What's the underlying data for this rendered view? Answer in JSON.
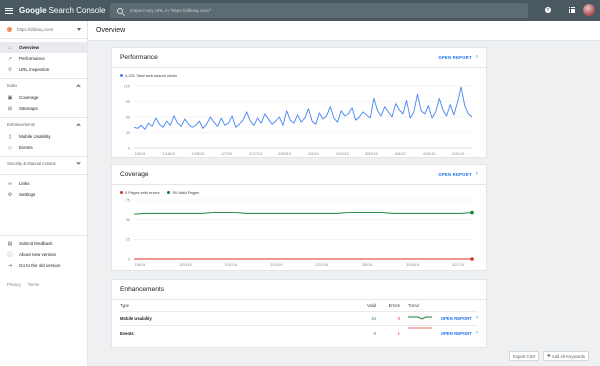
{
  "app": {
    "brand_g": "Google",
    "brand_text": "Search Console"
  },
  "search": {
    "placeholder": "Inspect any URL in \"https://dilinsq.com/\""
  },
  "header_icons": {
    "help": "?"
  },
  "property": {
    "url": "https://dilinsq.com/"
  },
  "sidebar": {
    "items": [
      {
        "label": "Overview",
        "icon": "home-icon"
      },
      {
        "label": "Performance",
        "icon": "trending-icon"
      },
      {
        "label": "URL inspection",
        "icon": "search-icon"
      }
    ],
    "index_section": "Index",
    "index_items": [
      {
        "label": "Coverage",
        "icon": "coverage-icon"
      },
      {
        "label": "Sitemaps",
        "icon": "sitemaps-icon"
      }
    ],
    "enh_section": "Enhancements",
    "enh_items": [
      {
        "label": "Mobile Usability",
        "icon": "phone-icon"
      },
      {
        "label": "Events",
        "icon": "events-icon"
      }
    ],
    "security_section": "Security & Manual Actions",
    "other_items": [
      {
        "label": "Links",
        "icon": "links-icon"
      },
      {
        "label": "Settings",
        "icon": "gear-icon"
      }
    ],
    "bottom_items": [
      {
        "label": "Submit feedback",
        "icon": "feedback-icon"
      },
      {
        "label": "About new version",
        "icon": "info-icon"
      },
      {
        "label": "Go to the old version",
        "icon": "exit-icon"
      }
    ],
    "footer": [
      "Privacy",
      "Terms"
    ]
  },
  "main": {
    "title": "Overview"
  },
  "performance": {
    "title": "Performance",
    "open": "OPEN REPORT",
    "legend": "4,231 Total web search clicks",
    "chart_data": {
      "type": "line",
      "series": [
        {
          "name": "4,231 Total web search clicks",
          "color": "#4285f4",
          "values": [
            40,
            38,
            44,
            36,
            48,
            42,
            58,
            46,
            40,
            52,
            44,
            62,
            48,
            42,
            56,
            46,
            40,
            44,
            52,
            38,
            46,
            60,
            50,
            42,
            58,
            44,
            48,
            62,
            40,
            46,
            54,
            70,
            52,
            44,
            58,
            48,
            66,
            56,
            46,
            52,
            60,
            44,
            72,
            54,
            48,
            64,
            50,
            58,
            76,
            52,
            46,
            68,
            56,
            62,
            80,
            58,
            50,
            72,
            62,
            66,
            78,
            54,
            60,
            70,
            64,
            58,
            96,
            72,
            62,
            80,
            70,
            60,
            86,
            74,
            66,
            92,
            58,
            70,
            104,
            72,
            66,
            82,
            58,
            70,
            96,
            74,
            62,
            84,
            64,
            88,
            118,
            82,
            66,
            60
          ]
        }
      ],
      "x_ticks": [
        "1/8/19",
        "1/18/19",
        "1/28/19",
        "2/7/19",
        "2/17/19",
        "2/28/19",
        "3/9/19",
        "3/19/19",
        "3/29/19",
        "4/8/19",
        "4/18/19",
        "4/31/19"
      ],
      "y_ticks": [
        "0",
        "30",
        "60",
        "90",
        "120"
      ],
      "ylim": [
        0,
        120
      ]
    }
  },
  "coverage": {
    "title": "Coverage",
    "open": "OPEN REPORT",
    "legend_errors": "0 Pages with errors",
    "legend_valid": "59 Valid Pages",
    "chart_data": {
      "type": "line",
      "series": [
        {
          "name": "59 Valid Pages",
          "color": "#188038",
          "values": [
            57,
            58,
            58,
            58,
            58,
            58,
            58,
            59,
            59,
            59,
            58,
            58,
            58,
            58,
            58,
            58,
            58,
            58,
            58,
            59,
            59,
            59,
            59,
            58,
            58,
            58,
            58,
            58,
            58,
            58,
            59
          ]
        },
        {
          "name": "0 Pages with errors",
          "color": "#d93025",
          "values": [
            0,
            0,
            0,
            0,
            0,
            0,
            0,
            0,
            0,
            0,
            0,
            0,
            0,
            0,
            0,
            0,
            0,
            0,
            0,
            0,
            0,
            0,
            0,
            0,
            0,
            0,
            0,
            0,
            0,
            0,
            0
          ]
        }
      ],
      "x_ticks": [
        "1/8/19",
        "1/20/19",
        "1/31/19",
        "2/11/19",
        "2/22/19",
        "3/5/19",
        "3/16/19",
        "3/27/19"
      ],
      "y_ticks": [
        "0",
        "25",
        "50",
        "75"
      ],
      "ylim": [
        0,
        75
      ]
    }
  },
  "enhancements": {
    "title": "Enhancements",
    "headers": {
      "type": "Type",
      "valid": "Valid",
      "errors": "Errors",
      "trend": "Trend"
    },
    "rows": [
      {
        "type": "Mobile Usability",
        "valid": "44",
        "errors": "0",
        "open": "OPEN REPORT"
      },
      {
        "type": "Events",
        "valid": "0",
        "errors": "1",
        "open": "OPEN REPORT"
      }
    ]
  },
  "actions": {
    "export": "Export CSV",
    "add_keywords": "Add All Keywords"
  }
}
